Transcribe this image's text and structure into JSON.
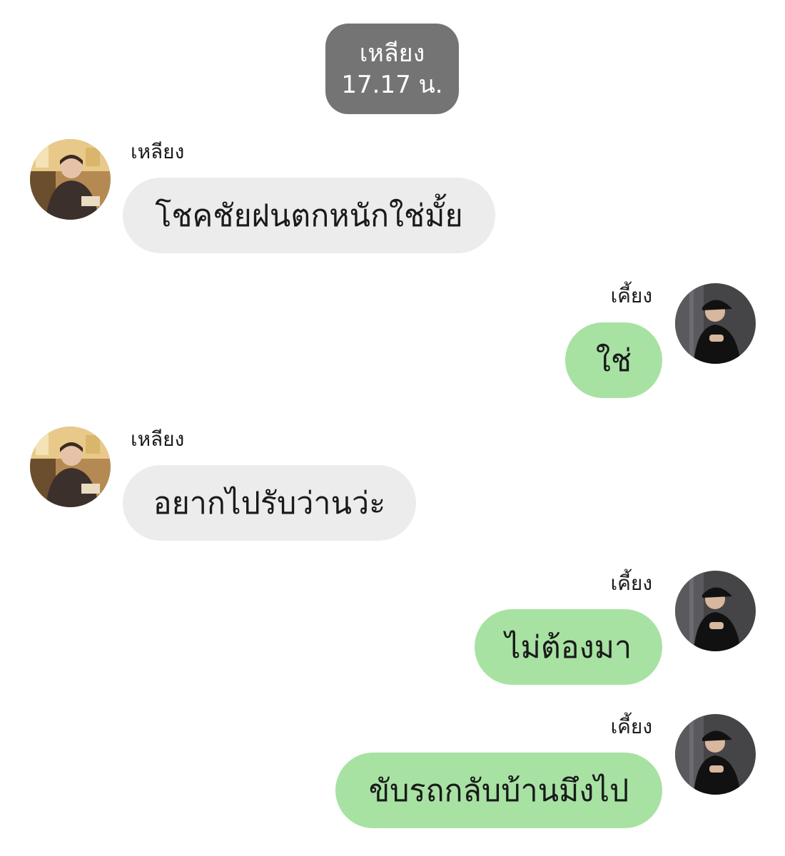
{
  "header": {
    "name": "เหลียง",
    "time": "17.17 น."
  },
  "colors": {
    "time_pill": "#747474",
    "incoming_bubble": "#ececec",
    "outgoing_bubble": "#a7e2a3",
    "background": "#ffffff"
  },
  "messages": [
    {
      "sender": "เหลียง",
      "direction": "incoming",
      "text": "โชคชัยฝนตกหนักใช่มั้ย",
      "avatar_icon": "profile-photo-icon"
    },
    {
      "sender": "เคี้ยง",
      "direction": "outgoing",
      "text": "ใช่",
      "avatar_icon": "profile-photo-icon"
    },
    {
      "sender": "เหลียง",
      "direction": "incoming",
      "text": "อยากไปรับว่านว่ะ",
      "avatar_icon": "profile-photo-icon"
    },
    {
      "sender": "เคี้ยง",
      "direction": "outgoing",
      "text": "ไม่ต้องมา",
      "avatar_icon": "profile-photo-icon"
    },
    {
      "sender": "เคี้ยง",
      "direction": "outgoing",
      "text": "ขับรถกลับบ้านมึงไป",
      "avatar_icon": "profile-photo-icon"
    }
  ]
}
